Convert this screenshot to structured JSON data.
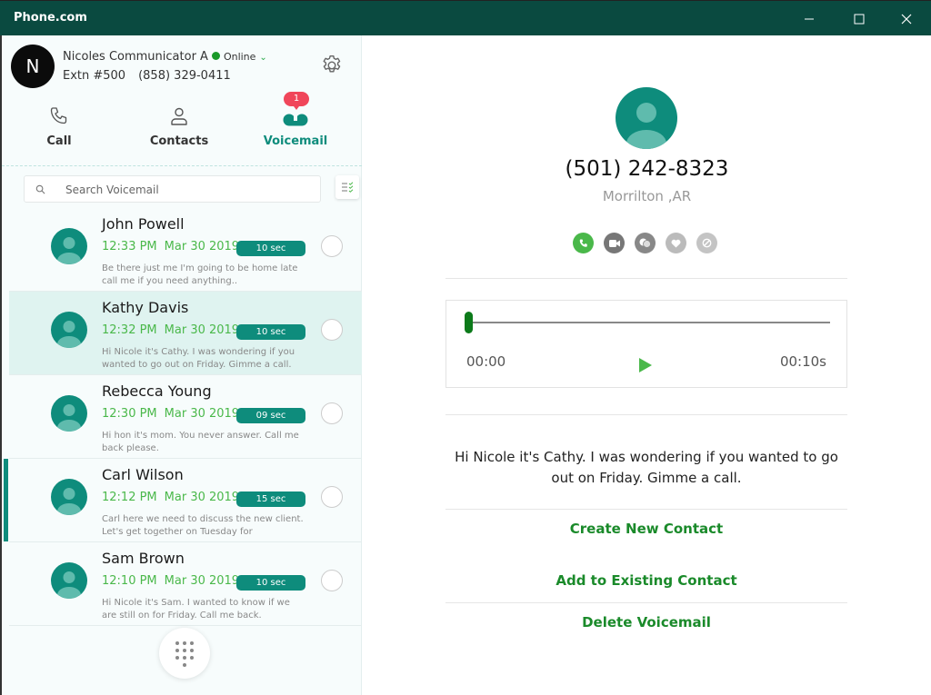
{
  "window": {
    "title": "Phone.com",
    "controls": {
      "minimize": "—",
      "maximize": "☐",
      "close": "✕"
    }
  },
  "profile": {
    "initial": "N",
    "name": "Nicoles Communicator A",
    "status": "Online",
    "extension": "Extn #500",
    "phone": "(858) 329-0411"
  },
  "tabs": [
    {
      "label": "Call",
      "icon": "phone-icon"
    },
    {
      "label": "Contacts",
      "icon": "person-icon"
    },
    {
      "label": "Voicemail",
      "icon": "voicemail-icon",
      "badge": "1",
      "active": true
    }
  ],
  "search": {
    "placeholder": "Search Voicemail",
    "value": ""
  },
  "voicemails": [
    {
      "name": "John Powell",
      "time": "12:33 PM",
      "date": "Mar 30 2019",
      "duration": "10 sec",
      "preview": "Be there just me I'm going to be home late  call me if you need anything.."
    },
    {
      "name": "Kathy Davis",
      "time": "12:32 PM",
      "date": "Mar 30 2019",
      "duration": "10 sec",
      "preview": "Hi Nicole it's Cathy. I was wondering if you wanted to go out on Friday. Gimme a call."
    },
    {
      "name": "Rebecca Young",
      "time": "12:30 PM",
      "date": "Mar 30 2019",
      "duration": "09 sec",
      "preview": "Hi hon it's mom. You never answer. Call me back please."
    },
    {
      "name": "Carl Wilson",
      "time": "12:12 PM",
      "date": "Mar 30 2019",
      "duration": "15 sec",
      "preview": "Carl here we need to discuss the new client. Let's get together on Tuesday for"
    },
    {
      "name": "Sam Brown",
      "time": "12:10 PM",
      "date": "Mar 30 2019",
      "duration": "10 sec",
      "preview": "Hi Nicole it's Sam. I wanted to know if we are still on for Friday. Call me back."
    }
  ],
  "detail": {
    "phone": "(501) 242-8323",
    "location": "Morrilton ,AR",
    "actions": [
      "call",
      "video",
      "message",
      "favorite",
      "block"
    ],
    "player": {
      "current": "00:00",
      "total": "00:10s",
      "progress": 0
    },
    "transcript": "Hi Nicole it's Cathy. I was wondering if you wanted to go out on Friday. Gimme a call.",
    "create_contact": "Create New Contact",
    "add_existing": "Add to Existing Contact",
    "delete": "Delete Voicemail"
  },
  "colors": {
    "brand": "#0a4a40",
    "accent": "#0e8c7c",
    "green": "#1a8a2a",
    "badge": "#f0465a"
  }
}
